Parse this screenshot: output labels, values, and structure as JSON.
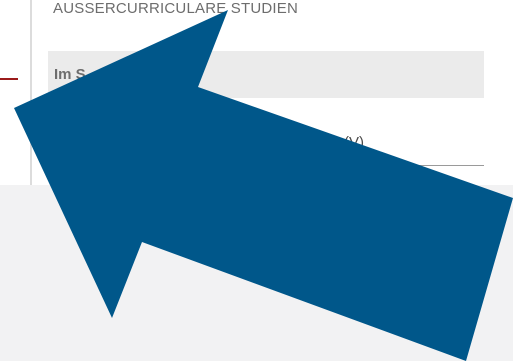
{
  "section": {
    "heading": "AUSSERCURRICULARE STUDIEN"
  },
  "nav": {
    "items": [
      {
        "label": "Im S",
        "active": true
      },
      {
        "label": "(V)",
        "active": false
      }
    ]
  },
  "colors": {
    "arrow": "#00578a",
    "accent_rule": "#9b1b1b",
    "overlay": "#f2f2f3"
  },
  "icons": {
    "pointer": "arrow-pointer-icon"
  }
}
